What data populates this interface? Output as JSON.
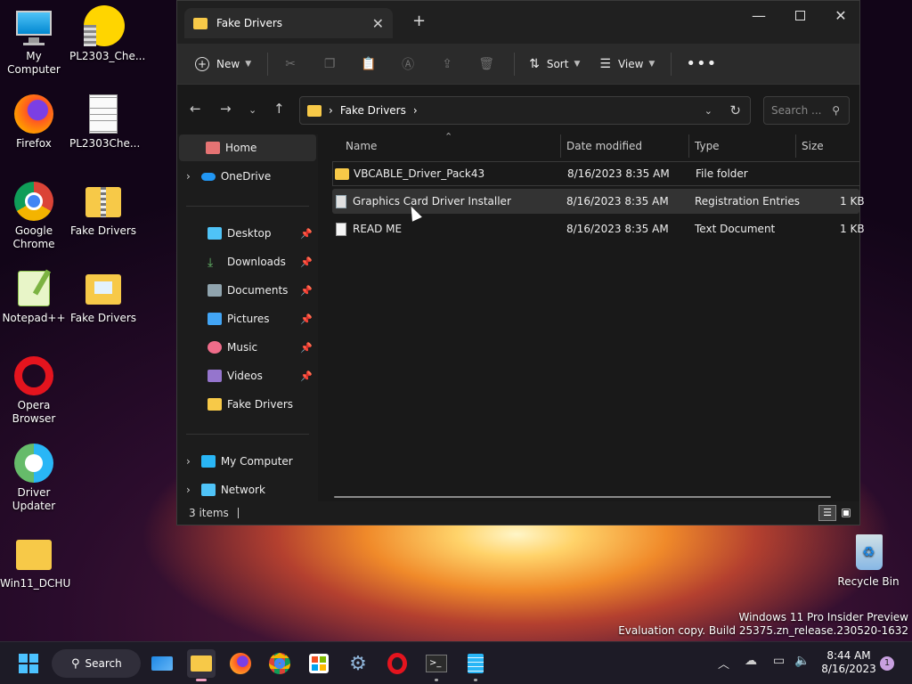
{
  "desktop": {
    "icons": [
      {
        "label": "My Computer",
        "icon": "monitor-icon"
      },
      {
        "label": "PL2303_Che...",
        "icon": "archive-icon"
      },
      {
        "label": "Firefox",
        "icon": "firefox-icon"
      },
      {
        "label": "PL2303Che...",
        "icon": "text-file-icon"
      },
      {
        "label": "Google Chrome",
        "icon": "chrome-icon"
      },
      {
        "label": "Fake Drivers",
        "icon": "zip-folder-icon"
      },
      {
        "label": "Notepad++",
        "icon": "notepadpp-icon"
      },
      {
        "label": "Fake Drivers",
        "icon": "folder-icon"
      },
      {
        "label": "Opera Browser",
        "icon": "opera-icon"
      },
      {
        "label": "Driver Updater",
        "icon": "driver-updater-icon"
      },
      {
        "label": "Win11_DCHU",
        "icon": "folder-icon"
      },
      {
        "label": "Recycle Bin",
        "icon": "recycle-bin-icon"
      }
    ],
    "watermark_line1": "Windows 11 Pro Insider Preview",
    "watermark_line2": "Evaluation copy. Build 25375.zn_release.230520-1632"
  },
  "explorer": {
    "tab_title": "Fake Drivers",
    "toolbar": {
      "new_label": "New",
      "sort_label": "Sort",
      "view_label": "View"
    },
    "address": {
      "crumb": "Fake Drivers"
    },
    "search_placeholder": "Search ...",
    "sidebar": {
      "home": "Home",
      "onedrive": "OneDrive",
      "quick": [
        "Desktop",
        "Downloads",
        "Documents",
        "Pictures",
        "Music",
        "Videos",
        "Fake Drivers"
      ],
      "my_computer": "My Computer",
      "network": "Network"
    },
    "columns": {
      "name": "Name",
      "date": "Date modified",
      "type": "Type",
      "size": "Size"
    },
    "files": [
      {
        "name": "VBCABLE_Driver_Pack43",
        "date": "8/16/2023 8:35 AM",
        "type": "File folder",
        "size": ""
      },
      {
        "name": "Graphics Card Driver Installer",
        "date": "8/16/2023 8:35 AM",
        "type": "Registration Entries",
        "size": "1 KB"
      },
      {
        "name": "READ ME",
        "date": "8/16/2023 8:35 AM",
        "type": "Text Document",
        "size": "1 KB"
      }
    ],
    "status": "3 items"
  },
  "taskbar": {
    "search_label": "Search",
    "time": "8:44 AM",
    "date": "8/16/2023",
    "notification_count": "1"
  }
}
